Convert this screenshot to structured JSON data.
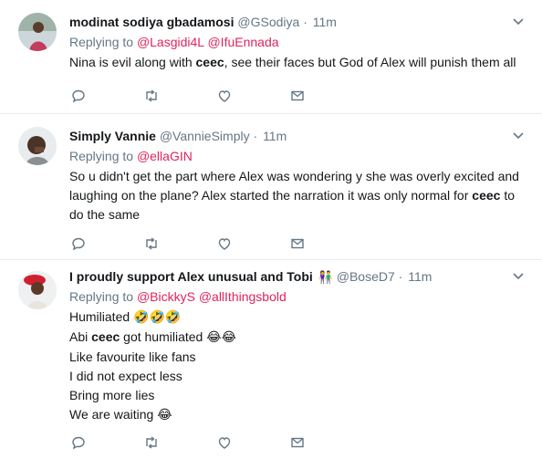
{
  "tweets": [
    {
      "fullname": "modinat sodiya gbadamosi",
      "handle": "@GSodiya",
      "dot": "·",
      "time": "11m",
      "replying_prefix": "Replying to ",
      "mentions": [
        "@Lasgidi4L",
        "@IfuEnnada"
      ],
      "lines": [
        {
          "before": "Nina is evil along with ",
          "bold": "ceec",
          "after": ", see their faces but God of Alex will punish them all"
        }
      ]
    },
    {
      "fullname": "Simply Vannie",
      "handle": "@VannieSimply",
      "dot": "·",
      "time": "11m",
      "replying_prefix": "Replying to ",
      "mentions": [
        "@ellaGIN"
      ],
      "lines": [
        {
          "before": "So u didn't get the part where Alex was wondering y she was overly excited and",
          "bold": "",
          "after": ""
        },
        {
          "before": "laughing on the plane? Alex started the narration it was only normal for ",
          "bold": "ceec",
          "after": " to"
        },
        {
          "before": "do the same",
          "bold": "",
          "after": ""
        }
      ]
    },
    {
      "fullname": "I proudly support Alex unusual and Tobi",
      "badge": "👫",
      "handle": "@BoseD7",
      "dot": "·",
      "time": "11m",
      "replying_prefix": "Replying to ",
      "mentions": [
        "@BickkyS",
        "@allIthingsbold"
      ],
      "lines": [
        {
          "before": "Humiliated ",
          "bold": "",
          "after": "",
          "emoji": "🤣🤣🤣"
        },
        {
          "before": "Abi ",
          "bold": "ceec",
          "after": " got humiliated ",
          "emoji": "😂😂"
        },
        {
          "before": "Like favourite like fans",
          "bold": "",
          "after": ""
        },
        {
          "before": "I did not expect less",
          "bold": "",
          "after": ""
        },
        {
          "before": "Bring more lies",
          "bold": "",
          "after": ""
        },
        {
          "before": "We are waiting ",
          "bold": "",
          "after": "",
          "emoji": "😂"
        }
      ]
    }
  ],
  "icons": {
    "reply": "reply-icon",
    "retweet": "retweet-icon",
    "like": "heart-icon",
    "dm": "envelope-icon",
    "caret": "chevron-down-icon"
  },
  "colors": {
    "mention": "#e0245e",
    "meta": "#657786",
    "icon": "#657786",
    "divider": "#e6ecf0"
  }
}
